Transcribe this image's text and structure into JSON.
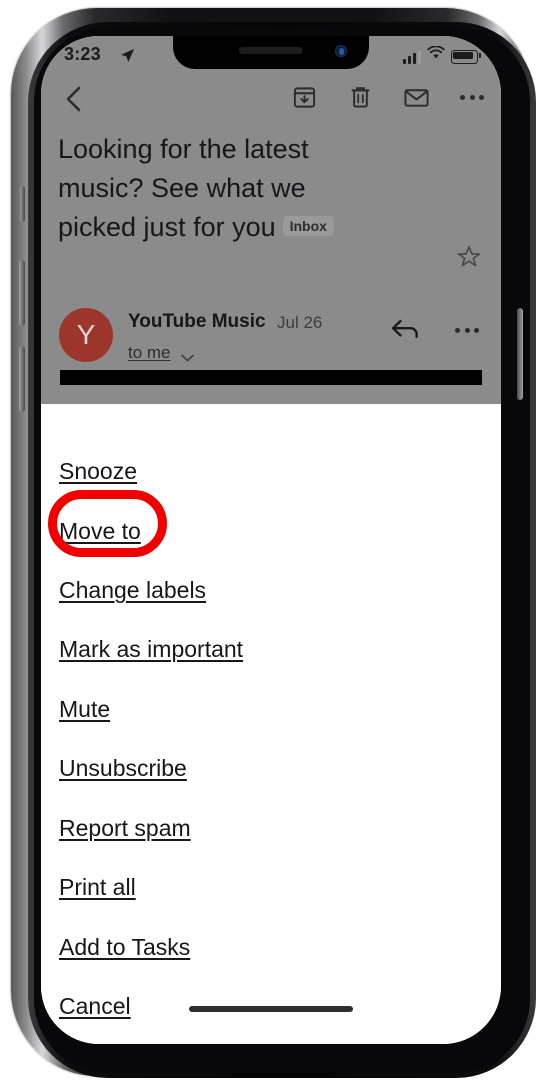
{
  "status_bar": {
    "time": "3:23",
    "location_icon": "location-arrow-icon",
    "signal_icon": "cellular-bars-icon",
    "wifi_icon": "wifi-icon",
    "battery_icon": "battery-full-icon"
  },
  "toolbar": {
    "back_icon": "chevron-left-icon",
    "archive_icon": "archive-box-icon",
    "delete_icon": "trash-icon",
    "mark_unread_icon": "envelope-icon",
    "overflow_icon": "overflow-dots-icon"
  },
  "email": {
    "subject": "Looking for the latest music? See what we picked just for you",
    "label_chip": "Inbox",
    "star_icon": "star-outline-icon",
    "sender_initial": "Y",
    "sender_name": "YouTube Music",
    "date": "Jul 26",
    "recipient": "to me",
    "recipient_caret_icon": "chevron-down-icon",
    "reply_icon": "reply-arrow-icon",
    "more_icon": "overflow-dots-icon"
  },
  "action_sheet": {
    "items": [
      {
        "label": "Snooze",
        "name": "snooze"
      },
      {
        "label": "Move to",
        "name": "move-to"
      },
      {
        "label": "Change labels",
        "name": "change-labels"
      },
      {
        "label": "Mark as important",
        "name": "mark-as-important"
      },
      {
        "label": "Mute",
        "name": "mute"
      },
      {
        "label": "Unsubscribe",
        "name": "unsubscribe"
      },
      {
        "label": "Report spam",
        "name": "report-spam"
      },
      {
        "label": "Print all",
        "name": "print-all"
      },
      {
        "label": "Add to Tasks",
        "name": "add-to-tasks"
      },
      {
        "label": "Cancel",
        "name": "cancel"
      }
    ],
    "highlight": {
      "target": "Move to",
      "color": "#f20000",
      "shape": "oval-outline"
    }
  },
  "colors": {
    "highlight_red": "#f20000",
    "avatar_red": "#9c362c",
    "dim_overlay": "#8b8b8b",
    "sheet_background": "#ffffff",
    "text_primary": "#17171a"
  },
  "home_indicator": "home-indicator"
}
